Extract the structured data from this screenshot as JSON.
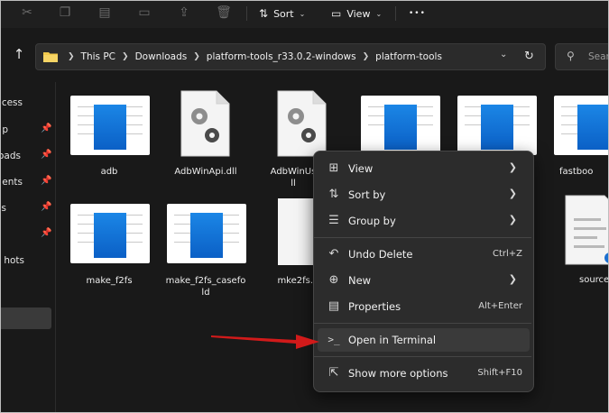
{
  "toolbar": {
    "sort_label": "Sort",
    "view_label": "View",
    "more_label": "•••"
  },
  "address": {
    "crumbs": [
      "This PC",
      "Downloads",
      "platform-tools_r33.0.2-windows",
      "platform-tools"
    ],
    "search_placeholder": "Sear"
  },
  "sidebar": {
    "items": [
      {
        "label": "cess",
        "pinned": false
      },
      {
        "label": "p",
        "pinned": true
      },
      {
        "label": "oads",
        "pinned": true
      },
      {
        "label": "ents",
        "pinned": true
      },
      {
        "label": "s",
        "pinned": true
      },
      {
        "label": "",
        "pinned": true
      },
      {
        "label": "hots",
        "pinned": false
      }
    ]
  },
  "files": [
    {
      "name": "adb",
      "icon": "exe-icon"
    },
    {
      "name": "AdbWinApi.dll",
      "icon": "dll-gear-icon"
    },
    {
      "name": "AdbWinUs\nll",
      "icon": "dll-gear-icon"
    },
    {
      "name": "",
      "icon": "exe-icon"
    },
    {
      "name": "",
      "icon": "exe-icon"
    },
    {
      "name": "fastboo",
      "icon": "exe-icon"
    },
    {
      "name": "make_f2fs",
      "icon": "exe-icon"
    },
    {
      "name": "make_f2fs_casefo\nld",
      "icon": "exe-icon"
    },
    {
      "name": "mke2fs.c",
      "icon": "blank-page-icon"
    },
    {
      "name": "source",
      "icon": "text-doc-icon"
    }
  ],
  "context_menu": {
    "items": [
      {
        "label": "View",
        "icon": "grid-icon",
        "shortcut": "",
        "submenu": true
      },
      {
        "label": "Sort by",
        "icon": "sort-icon",
        "shortcut": "",
        "submenu": true
      },
      {
        "label": "Group by",
        "icon": "list-icon",
        "shortcut": "",
        "submenu": true
      },
      {
        "label": "Undo Delete",
        "icon": "undo-icon",
        "shortcut": "Ctrl+Z",
        "submenu": false
      },
      {
        "label": "New",
        "icon": "plus-circle-icon",
        "shortcut": "",
        "submenu": true
      },
      {
        "label": "Properties",
        "icon": "properties-icon",
        "shortcut": "Alt+Enter",
        "submenu": false
      },
      {
        "label": "Open in Terminal",
        "icon": "terminal-icon",
        "shortcut": "",
        "submenu": false
      },
      {
        "label": "Show more options",
        "icon": "share-icon",
        "shortcut": "Shift+F10",
        "submenu": false
      }
    ]
  },
  "colors": {
    "background": "#191919",
    "menu": "#2c2c2c",
    "highlight": "#3a3a3a",
    "annotation_arrow": "#d11a1a",
    "folder": "#f2c94c",
    "exe_blue": "#0b6fd8"
  }
}
